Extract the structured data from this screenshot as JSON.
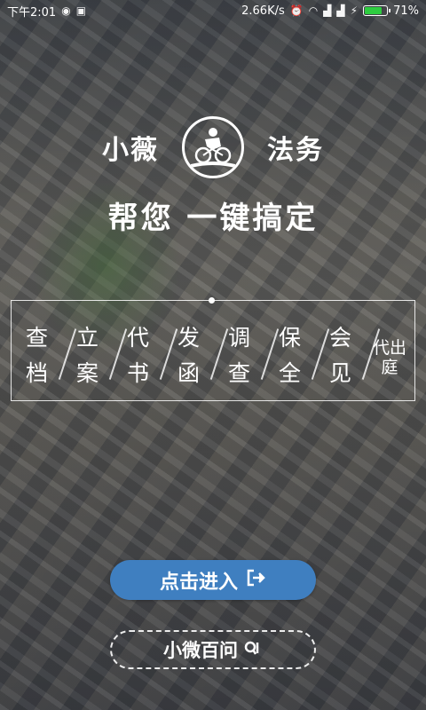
{
  "status_bar": {
    "time": "下午2:01",
    "speed": "2.66K/s",
    "battery_percent": "71%",
    "battery_level": 0.71,
    "battery_color": "#2ecc40",
    "icons": [
      "sim-icon",
      "wechat-icon",
      "alarm-icon",
      "wifi-icon",
      "signal-icon",
      "signal-icon",
      "charging-icon"
    ]
  },
  "logo": {
    "left": "小薇",
    "right": "法务",
    "emblem": "cyclist-emblem-icon"
  },
  "slogan": "帮您 一键搞定",
  "services": [
    {
      "top": "查",
      "bottom": "档"
    },
    {
      "top": "立",
      "bottom": "案"
    },
    {
      "top": "代",
      "bottom": "书"
    },
    {
      "top": "发",
      "bottom": "函"
    },
    {
      "top": "调",
      "bottom": "查"
    },
    {
      "top": "保",
      "bottom": "全"
    },
    {
      "top": "会",
      "bottom": "见"
    }
  ],
  "service_last": "代出庭",
  "enter_button": {
    "label": "点击进入",
    "color": "#3f7fc0"
  },
  "ask_button": {
    "label": "小微百问"
  }
}
